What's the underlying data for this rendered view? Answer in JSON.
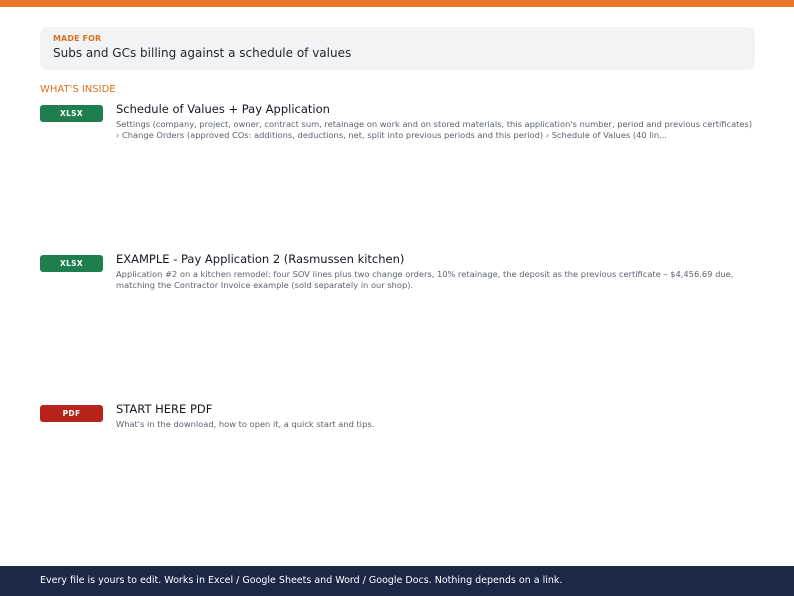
{
  "made_for": {
    "label": "MADE FOR",
    "text": "Subs and GCs billing against a schedule of values"
  },
  "whats_inside": {
    "heading": "WHAT'S INSIDE",
    "files": [
      {
        "type": "XLSX",
        "title": "Schedule of Values + Pay Application",
        "description": "Settings (company, project, owner, contract sum, retainage on work and on stored materials, this application's number, period and previous certificates) › Change Orders (approved COs: additions, deductions, net, split into previous periods and this period) › Schedule of Values (40 lin..."
      },
      {
        "type": "XLSX",
        "title": "EXAMPLE - Pay Application 2 (Rasmussen kitchen)",
        "description": "Application #2 on a kitchen remodel: four SOV lines plus two change orders, 10% retainage, the deposit as the previous certificate – $4,456.69 due, matching the Contractor Invoice example (sold separately in our shop)."
      },
      {
        "type": "PDF",
        "title": "START HERE PDF",
        "description": "What's in the download, how to open it, a quick start and tips."
      }
    ]
  },
  "footer": {
    "text": "Every file is yours to edit. Works in Excel / Google Sheets and Word / Google Docs. Nothing depends on a link."
  },
  "colors": {
    "accent": "#e8782a",
    "xlsx_badge": "#1e7e4e",
    "pdf_badge": "#b8231c",
    "footer_bg": "#1c2946"
  }
}
